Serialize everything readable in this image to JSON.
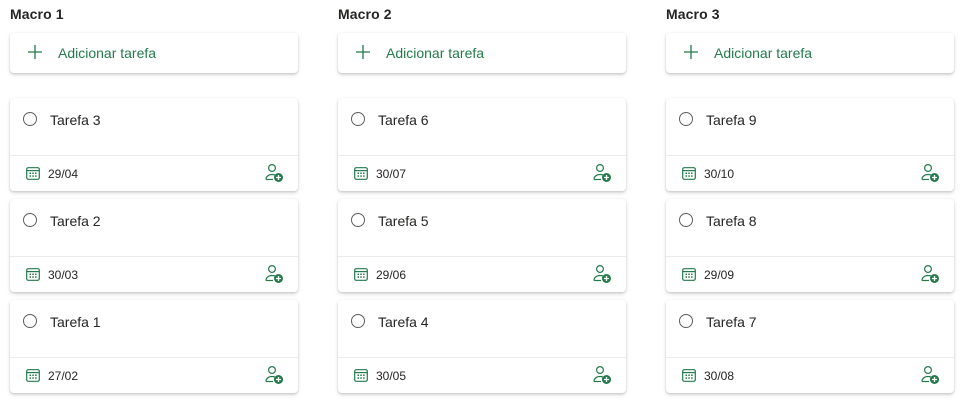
{
  "colors": {
    "accent": "#237b4b",
    "text": "#252423",
    "divider": "#edebe9"
  },
  "icons": {
    "add": "plus-icon",
    "check": "circle-icon",
    "due": "calendar-icon",
    "assign": "assign-user-icon"
  },
  "columns": [
    {
      "title": "Macro 1",
      "add_label": "Adicionar tarefa",
      "tasks": [
        {
          "name": "Tarefa 3",
          "due": "29/04"
        },
        {
          "name": "Tarefa 2",
          "due": "30/03"
        },
        {
          "name": "Tarefa 1",
          "due": "27/02"
        }
      ]
    },
    {
      "title": "Macro 2",
      "add_label": "Adicionar tarefa",
      "tasks": [
        {
          "name": "Tarefa 6",
          "due": "30/07"
        },
        {
          "name": "Tarefa 5",
          "due": "29/06"
        },
        {
          "name": "Tarefa 4",
          "due": "30/05"
        }
      ]
    },
    {
      "title": "Macro 3",
      "add_label": "Adicionar tarefa",
      "tasks": [
        {
          "name": "Tarefa 9",
          "due": "30/10"
        },
        {
          "name": "Tarefa 8",
          "due": "29/09"
        },
        {
          "name": "Tarefa 7",
          "due": "30/08"
        }
      ]
    }
  ]
}
